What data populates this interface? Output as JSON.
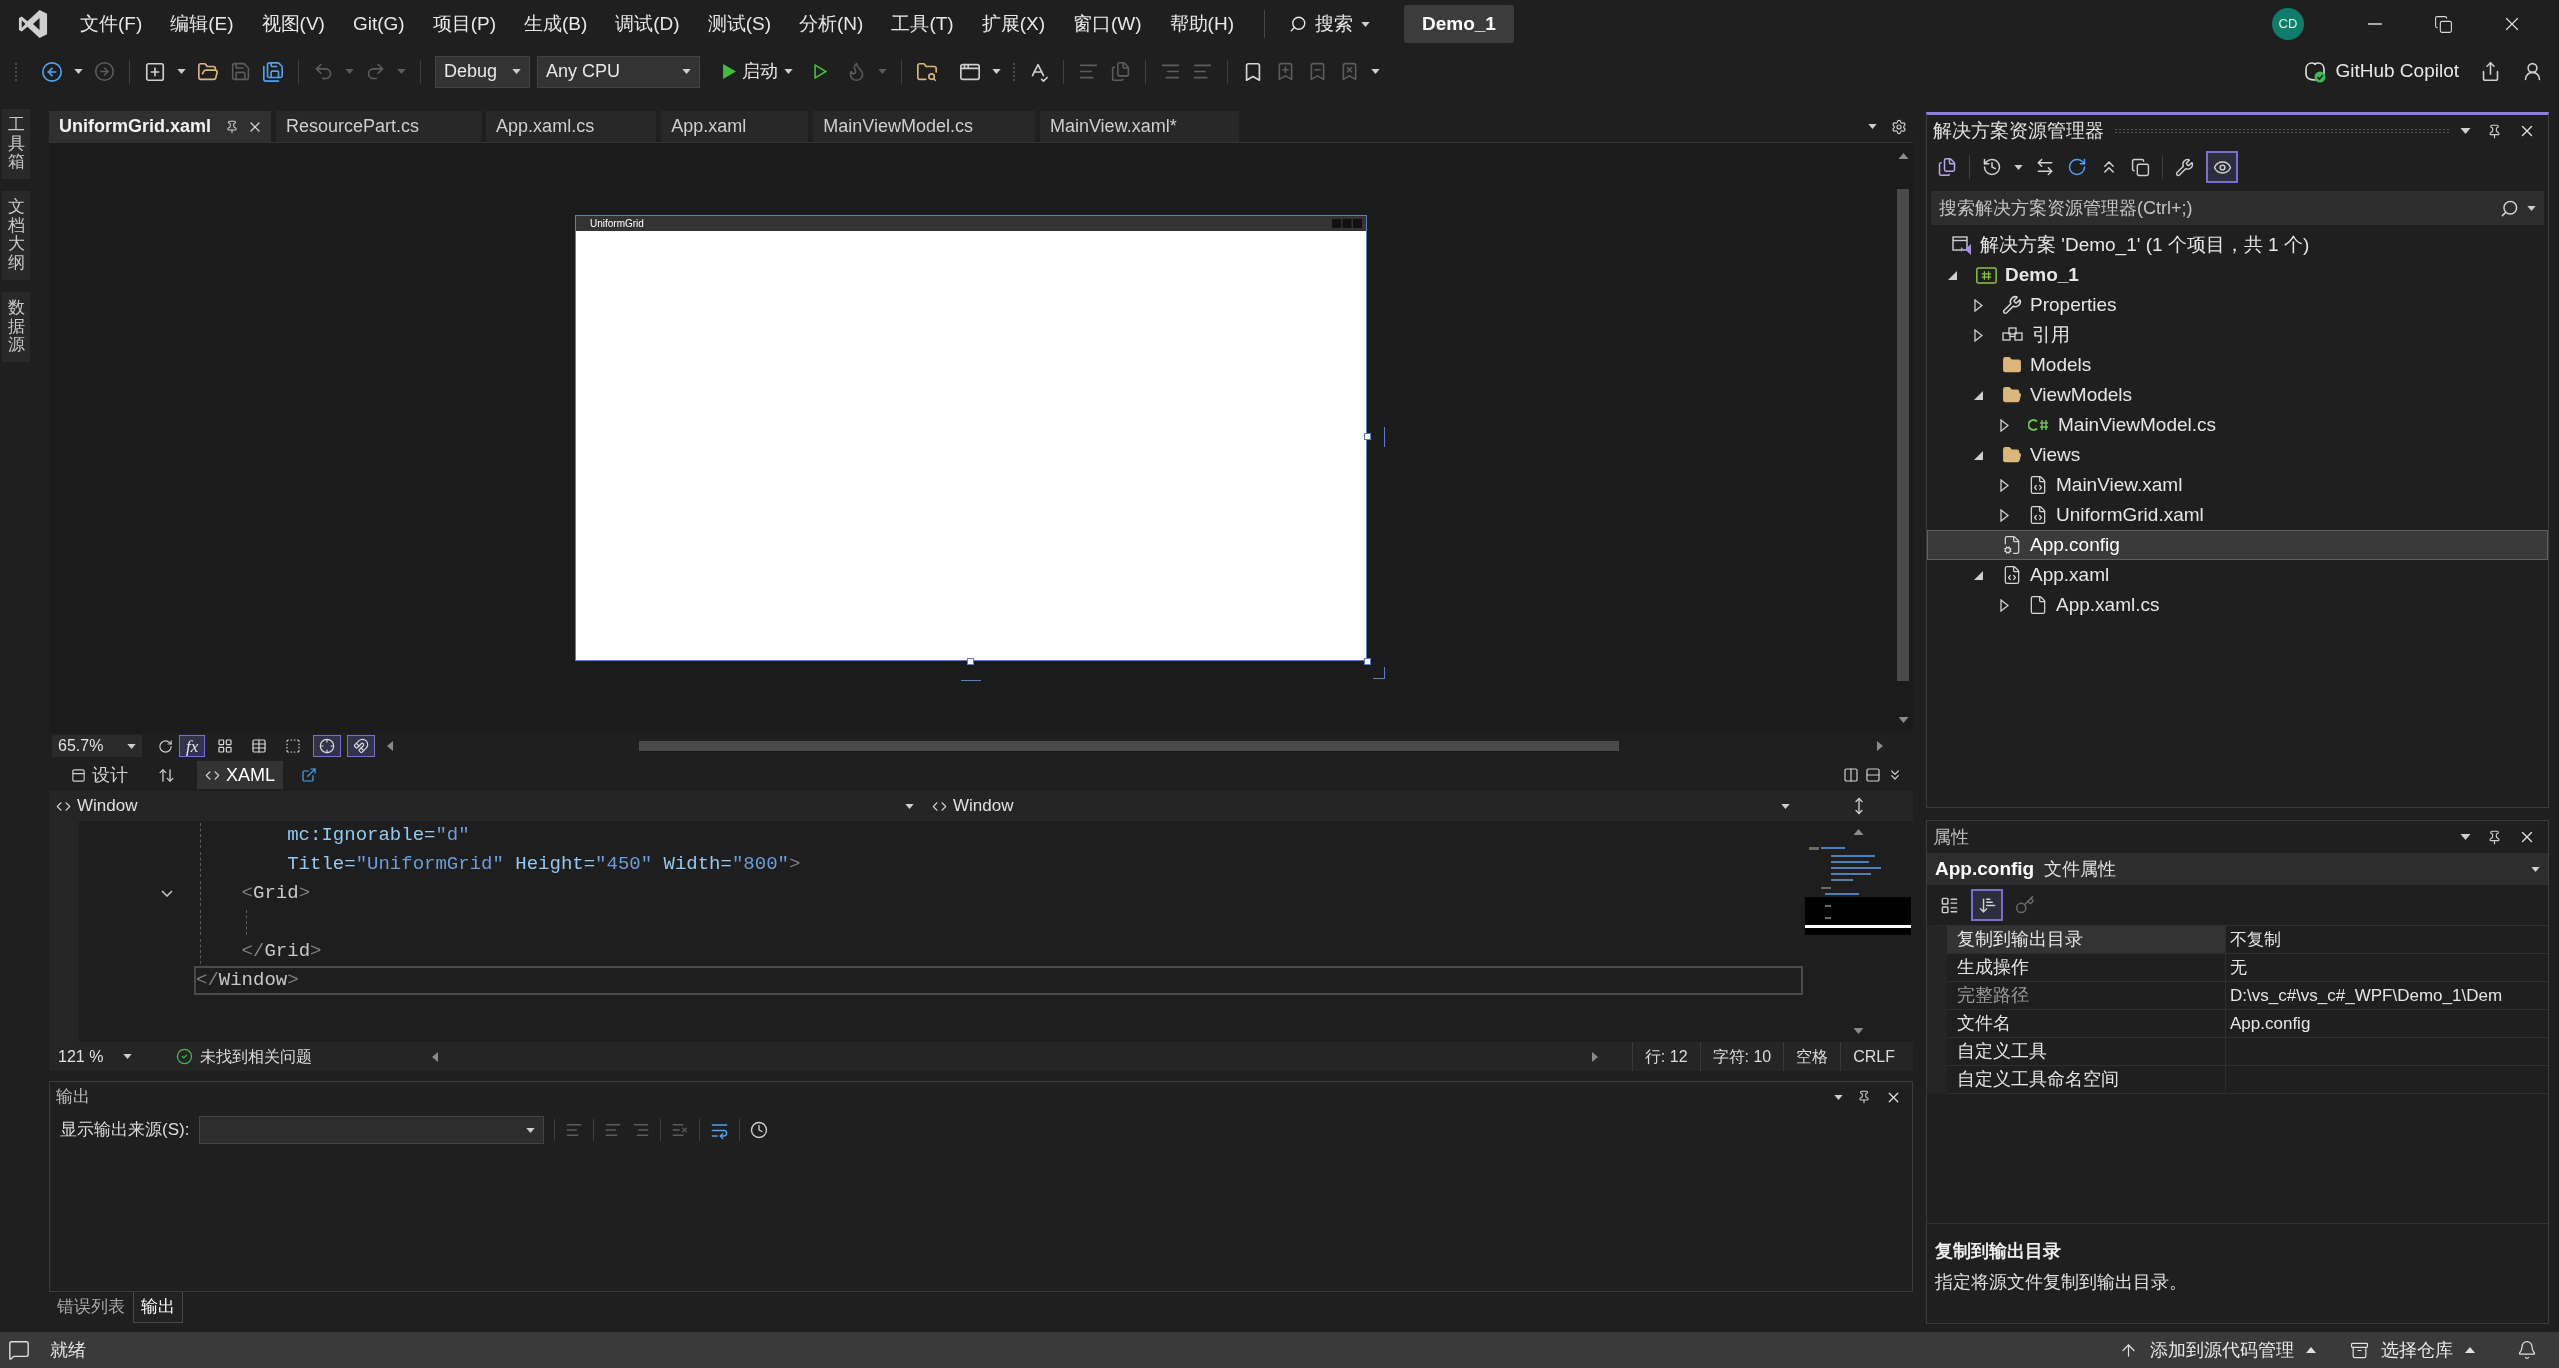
{
  "title_bar": {
    "menus": [
      "文件(F)",
      "编辑(E)",
      "视图(V)",
      "Git(G)",
      "项目(P)",
      "生成(B)",
      "调试(D)",
      "测试(S)",
      "分析(N)",
      "工具(T)",
      "扩展(X)",
      "窗口(W)",
      "帮助(H)"
    ],
    "search_label": "搜索",
    "solution_name": "Demo_1",
    "avatar_initials": "CD"
  },
  "toolbar": {
    "configuration": "Debug",
    "platform": "Any CPU",
    "start_label": "启动",
    "copilot_label": "GitHub Copilot"
  },
  "side_tabs": [
    "工具箱",
    "文档大纲",
    "数据源"
  ],
  "document_tabs": [
    {
      "label": "UniformGrid.xaml",
      "selected": true
    },
    {
      "label": "ResourcePart.cs",
      "selected": false
    },
    {
      "label": "App.xaml.cs",
      "selected": false
    },
    {
      "label": "App.xaml",
      "selected": false
    },
    {
      "label": "MainViewModel.cs",
      "selected": false
    },
    {
      "label": "MainView.xaml*",
      "selected": false
    }
  ],
  "designer": {
    "window_title": "UniformGrid",
    "zoom": "65.7%",
    "formula_button": {
      "label": "fx",
      "on": true
    },
    "toggles": [
      {
        "kind": "grid",
        "on": false
      },
      {
        "kind": "table",
        "on": false
      },
      {
        "kind": "checker",
        "on": false
      },
      {
        "kind": "snap-grid",
        "on": true
      },
      {
        "kind": "snap-lines",
        "on": true
      }
    ]
  },
  "view_tabs": [
    {
      "kind": "design",
      "label": "设计",
      "selected": false
    },
    {
      "kind": "xaml",
      "label": "XAML",
      "selected": true
    }
  ],
  "element_selectors": [
    "Window",
    "Window"
  ],
  "code_lines": [
    {
      "current": false,
      "foldable": false,
      "tokens": [
        {
          "kind": "attr",
          "text": "        mc:Ignorable="
        },
        {
          "kind": "value",
          "text": "\"d\""
        }
      ]
    },
    {
      "current": false,
      "foldable": false,
      "tokens": [
        {
          "kind": "attr",
          "text": "        Title="
        },
        {
          "kind": "value",
          "text": "\"UniformGrid\""
        },
        {
          "kind": "attr",
          "text": " Height="
        },
        {
          "kind": "value",
          "text": "\"450\""
        },
        {
          "kind": "attr",
          "text": " Width="
        },
        {
          "kind": "value",
          "text": "\"800\""
        },
        {
          "kind": "punct",
          "text": ">"
        }
      ]
    },
    {
      "current": false,
      "foldable": true,
      "tokens": [
        {
          "kind": "punct",
          "text": "    <"
        },
        {
          "kind": "tag",
          "text": "Grid"
        },
        {
          "kind": "punct",
          "text": ">"
        }
      ]
    },
    {
      "current": false,
      "foldable": false
    },
    {
      "current": false,
      "foldable": false,
      "tokens": [
        {
          "kind": "punct",
          "text": "    </"
        },
        {
          "kind": "tag",
          "text": "Grid"
        },
        {
          "kind": "punct",
          "text": ">"
        }
      ]
    },
    {
      "current": true,
      "foldable": false,
      "tokens": [
        {
          "kind": "punct",
          "text": "</"
        },
        {
          "kind": "tag",
          "text": "Window"
        },
        {
          "kind": "punct",
          "text": ">"
        }
      ]
    }
  ],
  "editor_status": {
    "zoom": "121 %",
    "issues": "未找到相关问题",
    "line": "行: 12",
    "column": "字符: 10",
    "whitespace": "空格",
    "line_ending": "CRLF"
  },
  "output_panel": {
    "title": "输出",
    "source_label": "显示输出来源(S):"
  },
  "bottom_tabs": [
    {
      "label": "错误列表",
      "selected": false
    },
    {
      "label": "输出",
      "selected": true
    }
  ],
  "solution_explorer": {
    "title": "解决方案资源管理器",
    "toolbar_toggle": {
      "on": true
    },
    "search_placeholder": "搜索解决方案资源管理器(Ctrl+;)",
    "tree": [
      {
        "label": "解决方案 'Demo_1' (1 个项目，共 1 个)",
        "kind": "solution",
        "selected": false,
        "children": [
          {
            "label": "Demo_1",
            "kind": "project",
            "selected": false,
            "expanded": true,
            "children": [
              {
                "label": "Properties",
                "kind": "properties",
                "selected": false,
                "expanded": false
              },
              {
                "label": "引用",
                "kind": "references",
                "selected": false,
                "expanded": false
              },
              {
                "label": "Models",
                "kind": "folder",
                "selected": false
              },
              {
                "label": "ViewModels",
                "kind": "folder",
                "selected": false,
                "expanded": true,
                "children": [
                  {
                    "label": "MainViewModel.cs",
                    "kind": "csharp",
                    "selected": false,
                    "expanded": false
                  }
                ]
              },
              {
                "label": "Views",
                "kind": "folder",
                "selected": false,
                "expanded": true,
                "children": [
                  {
                    "label": "MainView.xaml",
                    "kind": "xaml",
                    "selected": false,
                    "expanded": false
                  },
                  {
                    "label": "UniformGrid.xaml",
                    "kind": "xaml",
                    "selected": false,
                    "expanded": false
                  }
                ]
              },
              {
                "label": "App.config",
                "kind": "config",
                "selected": true
              },
              {
                "label": "App.xaml",
                "kind": "xaml",
                "selected": false,
                "expanded": true,
                "children": [
                  {
                    "label": "App.xaml.cs",
                    "kind": "code",
                    "selected": false,
                    "expanded": false
                  }
                ]
              }
            ]
          }
        ]
      }
    ]
  },
  "properties": {
    "title": "属性",
    "object_name": "App.config",
    "object_type": "文件属性",
    "view_buttons": [
      {
        "kind": "categorized",
        "selected": false
      },
      {
        "kind": "alphabetical",
        "selected": true
      }
    ],
    "rows": [
      {
        "name": "复制到输出目录",
        "value": "不复制",
        "selected": true,
        "read_only": false
      },
      {
        "name": "生成操作",
        "value": "无",
        "selected": false,
        "read_only": false
      },
      {
        "name": "完整路径",
        "value": "D:\\vs_c#\\vs_c#_WPF\\Demo_1\\Dem",
        "selected": false,
        "read_only": true
      },
      {
        "name": "文件名",
        "value": "App.config",
        "selected": false,
        "read_only": false
      },
      {
        "name": "自定义工具",
        "selected": false,
        "read_only": false
      },
      {
        "name": "自定义工具命名空间",
        "selected": false,
        "read_only": false
      }
    ],
    "description_title": "复制到输出目录",
    "description_text": "指定将源文件复制到输出目录。"
  },
  "status_bar": {
    "message": "就绪",
    "source_control": "添加到源代码管理",
    "repository": "选择仓库"
  }
}
